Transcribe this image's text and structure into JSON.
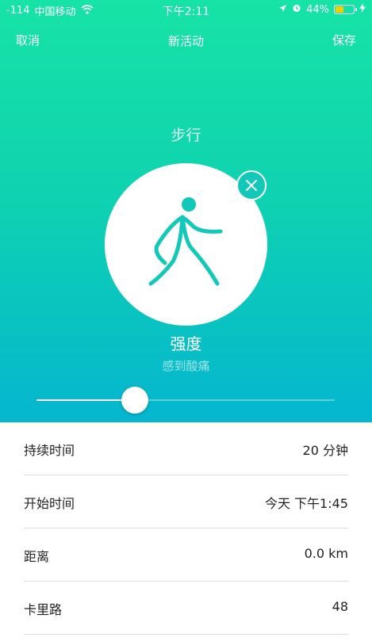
{
  "status_bar": {
    "signal": "-114",
    "carrier": "中国移动",
    "time": "下午2:11",
    "battery": "44%"
  },
  "nav": {
    "cancel": "取消",
    "title": "新活动",
    "save": "保存"
  },
  "activity": {
    "name": "步行",
    "icon": "walking-person-icon"
  },
  "intensity": {
    "label": "强度",
    "value": "感到酸痛",
    "slider_level": 0.33
  },
  "details": [
    {
      "label": "持续时间",
      "value": "20 分钟"
    },
    {
      "label": "开始时间",
      "value": "今天 下午1:45"
    },
    {
      "label": "距离",
      "value": "0.0 km"
    },
    {
      "label": "卡里路",
      "value": "48"
    }
  ],
  "colors": {
    "gradient_top": "#17e3a6",
    "gradient_bottom": "#05b6cf",
    "icon_color": "#12c8b8",
    "battery_fill": "#f5d000"
  }
}
